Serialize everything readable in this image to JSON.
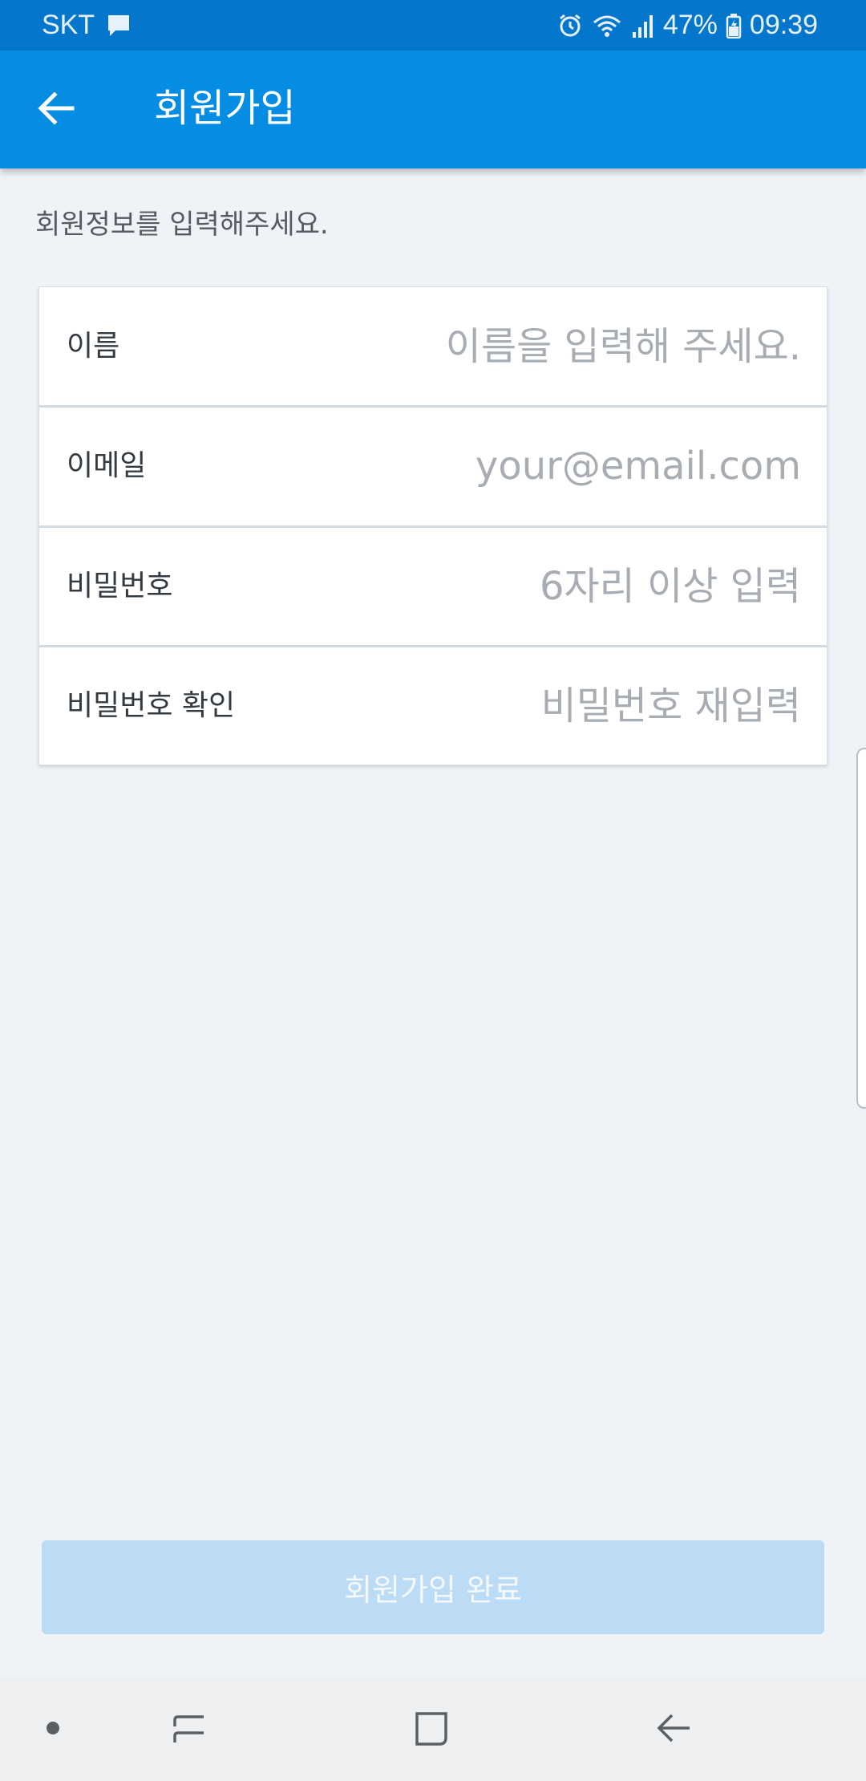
{
  "status_bar": {
    "carrier": "SKT",
    "battery_percent": "47%",
    "time": "09:39",
    "icons": [
      "chat-bubble-icon",
      "alarm-icon",
      "wifi-icon",
      "signal-icon",
      "battery-icon"
    ]
  },
  "app_bar": {
    "title": "회원가입",
    "back_icon": "back-arrow-icon"
  },
  "instruction": "회원정보를 입력해주세요.",
  "form": {
    "fields": [
      {
        "label": "이름",
        "value": "",
        "placeholder": "이름을 입력해 주세요."
      },
      {
        "label": "이메일",
        "value": "",
        "placeholder": "your@email.com"
      },
      {
        "label": "비밀번호",
        "value": "",
        "placeholder": "6자리 이상 입력"
      },
      {
        "label": "비밀번호 확인",
        "value": "",
        "placeholder": "비밀번호 재입력"
      }
    ]
  },
  "submit_button": {
    "label": "회원가입 완료",
    "enabled": false
  },
  "nav_bar": {
    "items": [
      "dot-icon",
      "recent-apps-icon",
      "home-icon",
      "nav-back-icon"
    ]
  },
  "colors": {
    "status_bar": "#0477cc",
    "app_bar": "#058de4",
    "background": "#eff3f7",
    "button_disabled": "#bcdcf6",
    "placeholder": "#a7adb2"
  }
}
